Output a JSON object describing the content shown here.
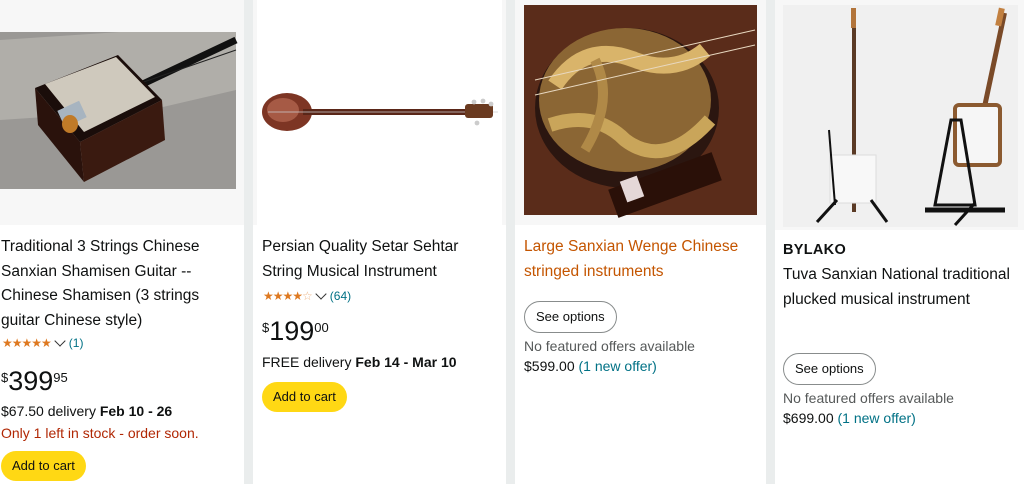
{
  "products": [
    {
      "title": "Traditional 3 Strings Chinese Sanxian Shamisen Guitar -- Chinese Shamisen (3 strings guitar Chinese style)",
      "rating_count": "(1)",
      "rating_stars": 5,
      "price": {
        "symbol": "$",
        "whole": "399",
        "fraction": "95"
      },
      "delivery_price": "$67.50 delivery ",
      "delivery_dates": "Feb 10 - 26",
      "stock_note": "Only 1 left in stock - order soon.",
      "button": "Add to cart",
      "image_icon": "shamisen-photo"
    },
    {
      "title": "Persian Quality Setar Sehtar String Musical Instrument",
      "rating_count": "(64)",
      "rating_stars": 4,
      "price": {
        "symbol": "$",
        "whole": "199",
        "fraction": "00"
      },
      "delivery_label": "FREE delivery ",
      "delivery_dates": "Feb 14 - Mar 10",
      "button": "Add to cart",
      "image_icon": "setar-photo"
    },
    {
      "title": "Large Sanxian Wenge Chinese stringed instruments",
      "button": "See options",
      "offers_note": "No featured offers available",
      "offer_price": "$599.00",
      "offer_link": "(1 new offer)",
      "image_icon": "sanxian-snakeskin-photo"
    },
    {
      "brand": "BYLAKO",
      "title": "Tuva Sanxian National traditional plucked musical instrument",
      "button": "See options",
      "offers_note": "No featured offers available",
      "offer_price": "$699.00",
      "offer_link": "(1 new offer)",
      "image_icon": "sanxian-on-stand-photo"
    }
  ],
  "colors": {
    "cart_button": "#ffd814",
    "star": "#de7921",
    "link": "#007185",
    "stock_warning": "#b12704",
    "sponsored_title": "#c45500"
  }
}
